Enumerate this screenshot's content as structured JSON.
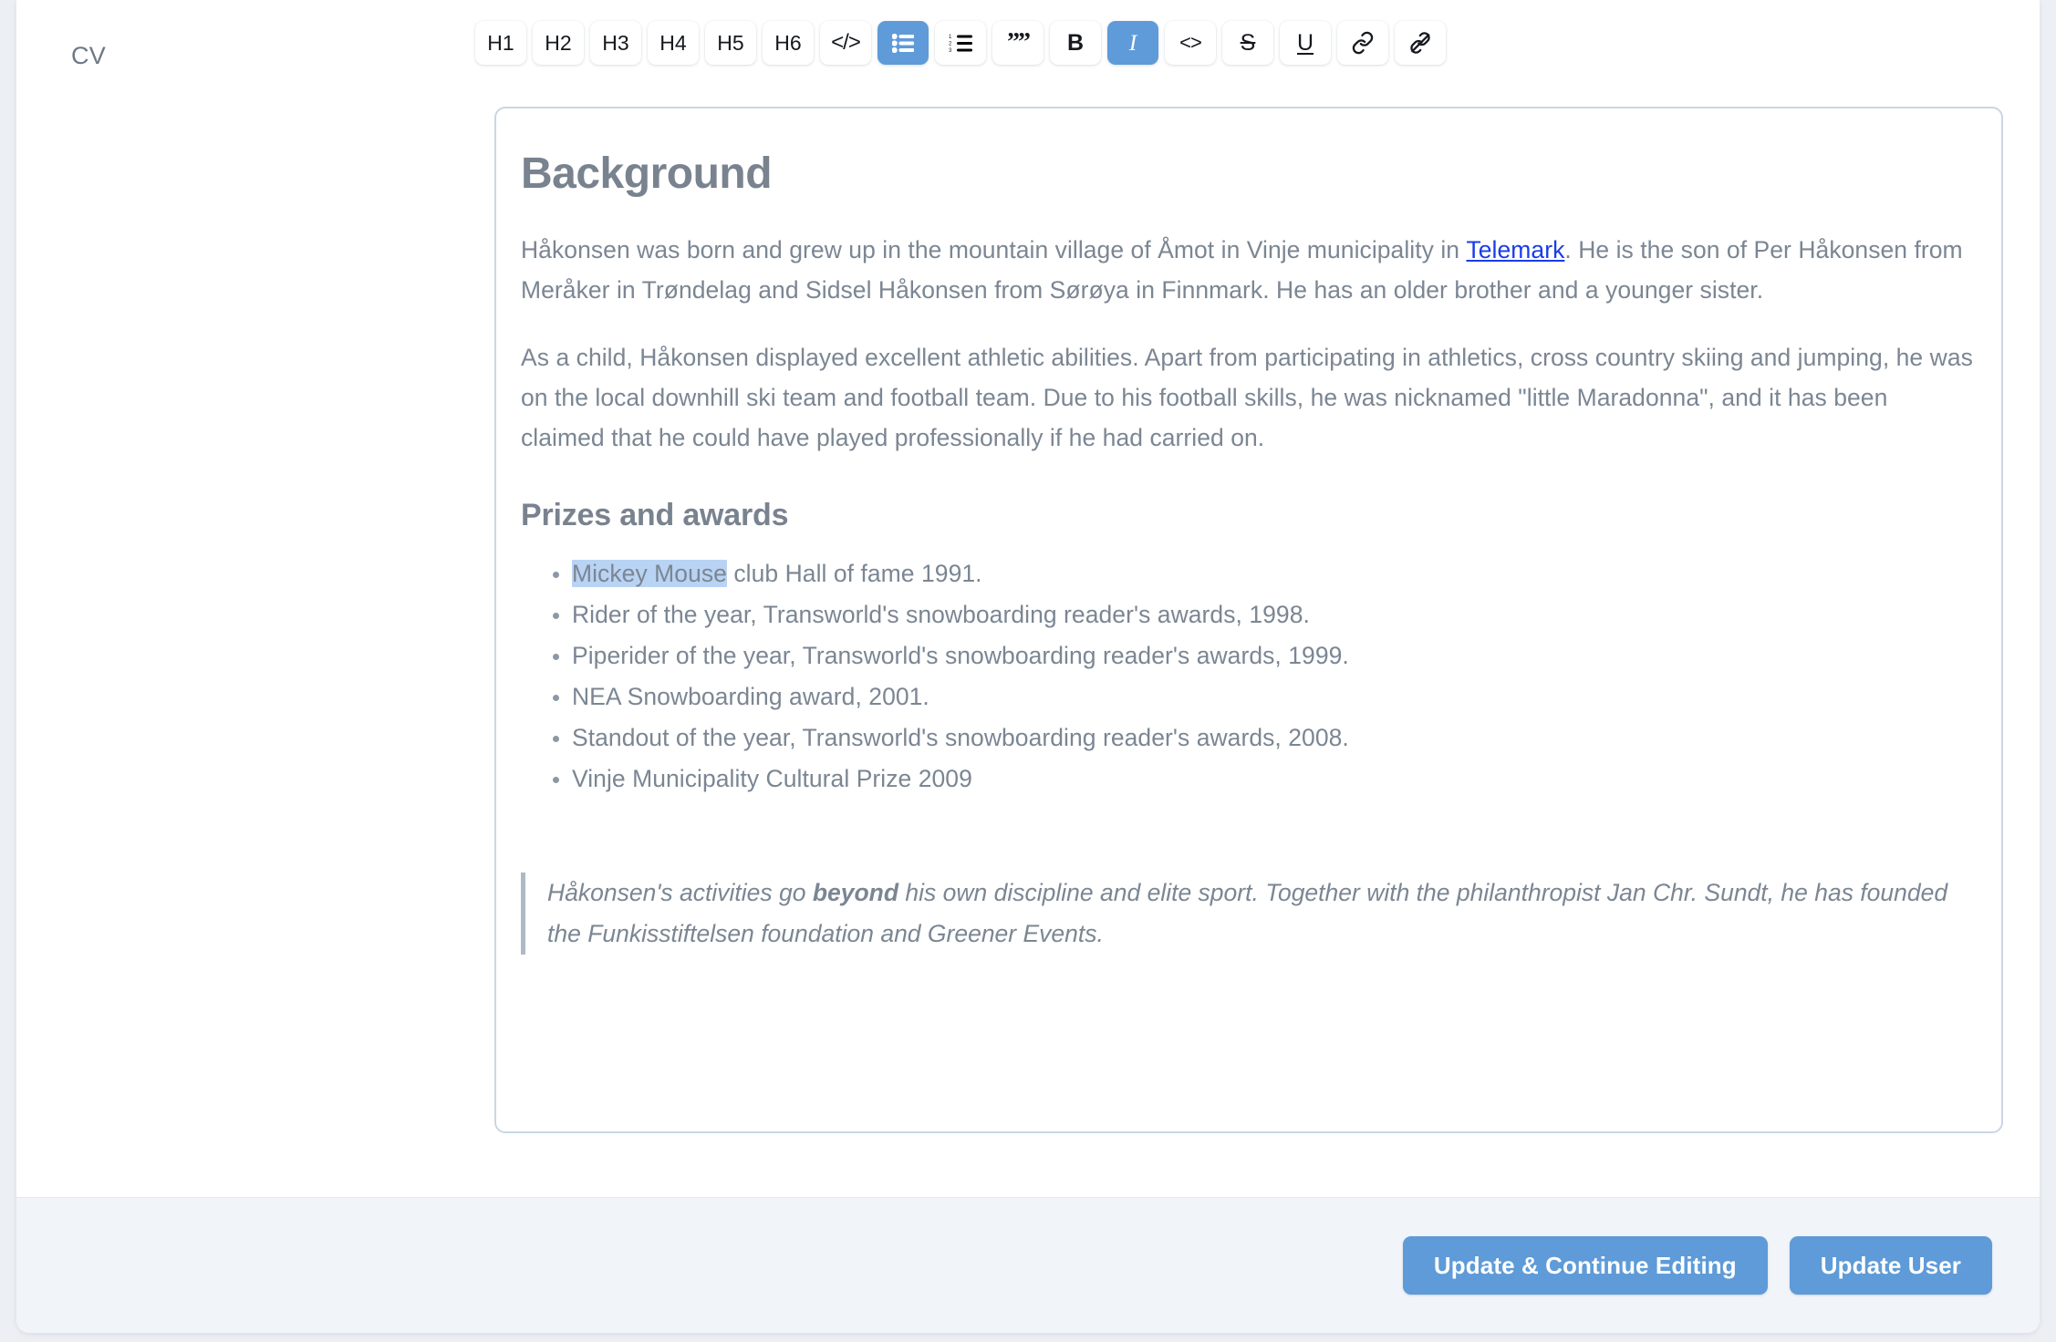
{
  "field": {
    "label": "CV"
  },
  "toolbar": {
    "buttons": [
      {
        "name": "heading-1",
        "label": "H1",
        "kind": "text",
        "active": false
      },
      {
        "name": "heading-2",
        "label": "H2",
        "kind": "text",
        "active": false
      },
      {
        "name": "heading-3",
        "label": "H3",
        "kind": "text",
        "active": false
      },
      {
        "name": "heading-4",
        "label": "H4",
        "kind": "text",
        "active": false
      },
      {
        "name": "heading-5",
        "label": "H5",
        "kind": "text",
        "active": false
      },
      {
        "name": "heading-6",
        "label": "H6",
        "kind": "text",
        "active": false
      },
      {
        "name": "code-block-icon",
        "label": "</>",
        "kind": "text",
        "active": false
      },
      {
        "name": "bulleted-list-icon",
        "label": "",
        "kind": "icon",
        "active": true
      },
      {
        "name": "numbered-list-icon",
        "label": "",
        "kind": "icon",
        "active": false
      },
      {
        "name": "blockquote-icon",
        "label": "””",
        "kind": "text",
        "active": false
      },
      {
        "name": "bold",
        "label": "B",
        "kind": "text",
        "active": false
      },
      {
        "name": "italic",
        "label": "I",
        "kind": "text",
        "active": true
      },
      {
        "name": "inline-code-icon",
        "label": "<>",
        "kind": "text",
        "active": false
      },
      {
        "name": "strikethrough",
        "label": "S",
        "kind": "text",
        "active": false
      },
      {
        "name": "underline",
        "label": "U",
        "kind": "text",
        "active": false
      },
      {
        "name": "link-icon",
        "label": "",
        "kind": "icon",
        "active": false
      },
      {
        "name": "unlink-icon",
        "label": "",
        "kind": "icon",
        "active": false
      }
    ]
  },
  "document": {
    "heading": "Background",
    "paragraph_1": {
      "before_link": "Håkonsen was born and grew up in the mountain village of Åmot in Vinje municipality in ",
      "link_text": "Telemark",
      "after_link": ". He is the son of Per Håkonsen from Meråker in Trøndelag and Sidsel Håkonsen from Sørøya in Finnmark. He has an older brother and a younger sister."
    },
    "paragraph_2": "As a child, Håkonsen displayed excellent athletic abilities. Apart from participating in athletics, cross country skiing and jumping, he was on the local downhill ski team and football team. Due to his football skills, he was nicknamed \"little Maradonna\", and it has been claimed that he could have played professionally if he had carried on.",
    "subheading": "Prizes and awards",
    "awards": [
      {
        "highlighted": "Mickey Mouse",
        "rest": " club Hall of fame 1991."
      },
      {
        "highlighted": "",
        "rest": "Rider of the year, Transworld's snowboarding reader's awards, 1998."
      },
      {
        "highlighted": "",
        "rest": "Piperider of the year, Transworld's snowboarding reader's awards, 1999."
      },
      {
        "highlighted": "",
        "rest": "NEA Snowboarding award, 2001."
      },
      {
        "highlighted": "",
        "rest": "Standout of the year, Transworld's snowboarding reader's awards, 2008."
      },
      {
        "highlighted": "",
        "rest": "Vinje Municipality Cultural Prize 2009"
      }
    ],
    "blockquote": {
      "part_1": "Håkonsen's activities go ",
      "bold": "beyond",
      "part_2": " his own discipline and elite sport. Together with the philanthropist Jan Chr. Sundt, he has founded the Funkisstiftelsen foundation and Greener Events."
    }
  },
  "footer": {
    "update_continue_label": "Update & Continue Editing",
    "update_user_label": "Update User"
  },
  "colors": {
    "accent": "#5e9bd8",
    "text": "#7b8693",
    "link": "#1a3ce8",
    "selection": "#b9d3f4",
    "card_border": "#c9d6e4",
    "footer_bg": "#f1f4f8"
  }
}
